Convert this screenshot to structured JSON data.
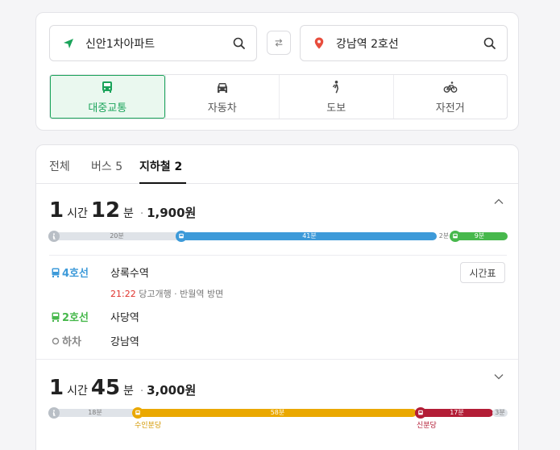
{
  "search": {
    "from": "신안1차아파트",
    "to": "강남역 2호선"
  },
  "modes": [
    {
      "label": "대중교통",
      "icon": "bus-icon"
    },
    {
      "label": "자동차",
      "icon": "car-icon"
    },
    {
      "label": "도보",
      "icon": "walk-icon"
    },
    {
      "label": "자전거",
      "icon": "bike-icon"
    }
  ],
  "tabs": [
    "전체",
    "버스 5",
    "지하철 2"
  ],
  "routes": [
    {
      "hours": "1",
      "hour_unit": "시간",
      "mins": "12",
      "min_unit": "분",
      "dot": "·",
      "fare": "1,900원",
      "progress": {
        "walk1": "20분",
        "line1": "41분",
        "walk2": "2분",
        "line2": "9분"
      },
      "steps": [
        {
          "line": "4호선",
          "station": "상록수역"
        },
        {
          "line": "2호선",
          "station": "사당역"
        },
        {
          "line": "하차",
          "station": "강남역"
        }
      ],
      "detail_time": "21:22",
      "detail_text": "당고개행 · 반월역 방면",
      "schedule_button": "시간표"
    },
    {
      "hours": "1",
      "hour_unit": "시간",
      "mins": "45",
      "min_unit": "분",
      "dot": "·",
      "fare": "3,000원",
      "progress": {
        "walk1": "18분",
        "line1": "58분",
        "line2": "17분",
        "walk2": "3분"
      },
      "stop1": "수인분당",
      "stop2": "신분당"
    }
  ],
  "colors": {
    "accent": "#1aa35a",
    "line4": "#3d9ad9",
    "line2": "#47b84c",
    "suin_bundang": "#eaa800",
    "sin_bundang": "#b31d36",
    "time_red": "#e0312b"
  }
}
